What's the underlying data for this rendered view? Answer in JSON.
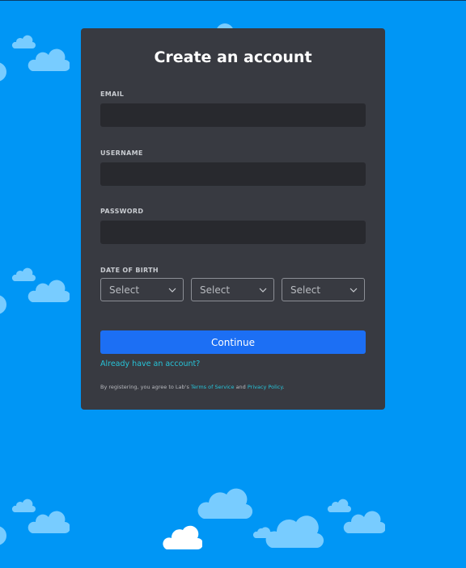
{
  "form": {
    "title": "Create an account",
    "email_label": "EMAIL",
    "email_value": "",
    "username_label": "USERNAME",
    "username_value": "",
    "password_label": "PASSWORD",
    "password_value": "",
    "dob_label": "DATE OF BIRTH",
    "dob_selects": [
      {
        "placeholder": "Select"
      },
      {
        "placeholder": "Select"
      },
      {
        "placeholder": "Select"
      }
    ],
    "continue_label": "Continue",
    "login_link": "Already have an account?",
    "legal": {
      "prefix": "By registering, you agree to Lab's",
      "terms": "Terms of Service",
      "and": "and",
      "privacy": "Privacy Policy",
      "suffix": "."
    }
  },
  "colors": {
    "background": "#0096f5",
    "card": "#383a41",
    "input": "#28292e",
    "button": "#1c6ff4",
    "link": "#27c3d8",
    "cloud_light": "#78ccff",
    "cloud_white": "#ffffff"
  }
}
